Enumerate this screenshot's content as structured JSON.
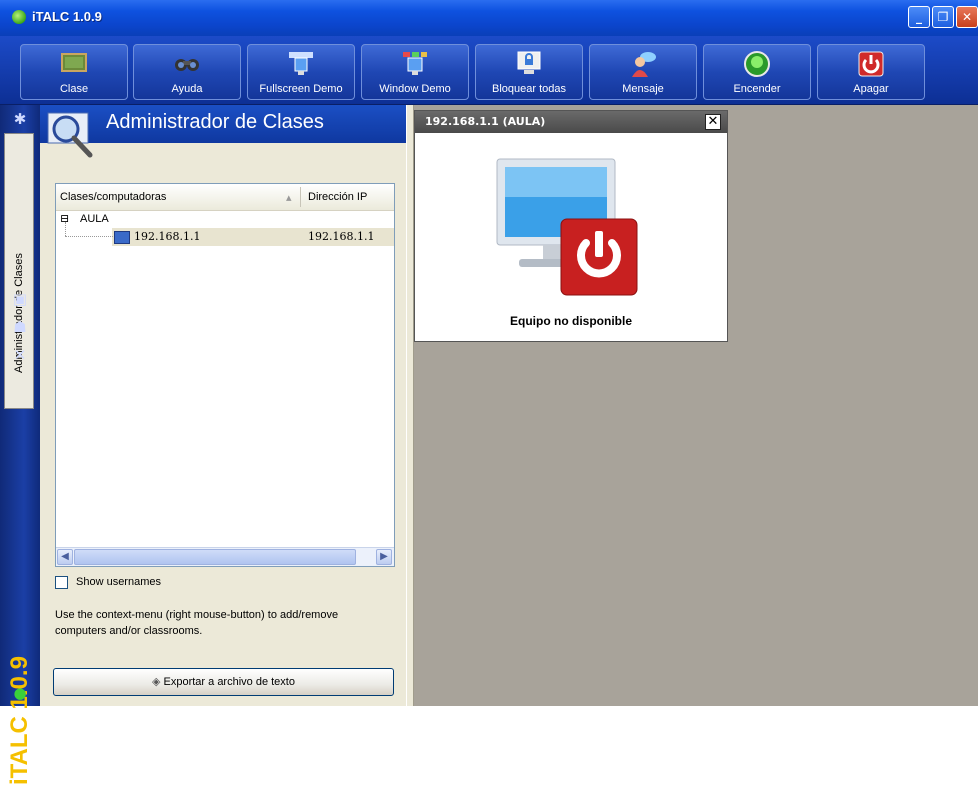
{
  "window": {
    "title": "iTALC 1.0.9",
    "min": "_",
    "max": "❐",
    "close": "✕"
  },
  "toolbar": {
    "buttons": [
      {
        "label": "Clase",
        "icon": "classroom-icon"
      },
      {
        "label": "Ayuda",
        "icon": "help-icon"
      },
      {
        "label": "Fullscreen Demo",
        "icon": "fullscreen-demo-icon"
      },
      {
        "label": "Window Demo",
        "icon": "window-demo-icon"
      },
      {
        "label": "Bloquear todas",
        "icon": "lock-all-icon"
      },
      {
        "label": "Mensaje",
        "icon": "message-icon"
      },
      {
        "label": "Encender",
        "icon": "power-on-icon"
      },
      {
        "label": "Apagar",
        "icon": "power-off-icon"
      }
    ]
  },
  "sidebar": {
    "active_tab": "Administrador de Clases",
    "brand": "iTALC 1.0.9"
  },
  "class_manager": {
    "title": "Administrador de Clases",
    "columns": [
      "Clases/computadoras",
      "Dirección IP"
    ],
    "tree": [
      {
        "expander": "⊟",
        "label": "AULA",
        "ip": ""
      },
      {
        "label": "192.168.1.1",
        "ip": "192.168.1.1"
      }
    ],
    "show_usernames_label": "Show usernames",
    "hint": "Use the context-menu (right mouse-button) to add/remove computers and/or classrooms.",
    "export_button": "Exportar a archivo de texto"
  },
  "client_window": {
    "title": "192.168.1.1 (AULA)",
    "close": "✕",
    "status": "Equipo no disponible"
  },
  "colors": {
    "accent": "#0e52e0",
    "workspace": "#a8a39a",
    "brand": "#f5c000"
  }
}
